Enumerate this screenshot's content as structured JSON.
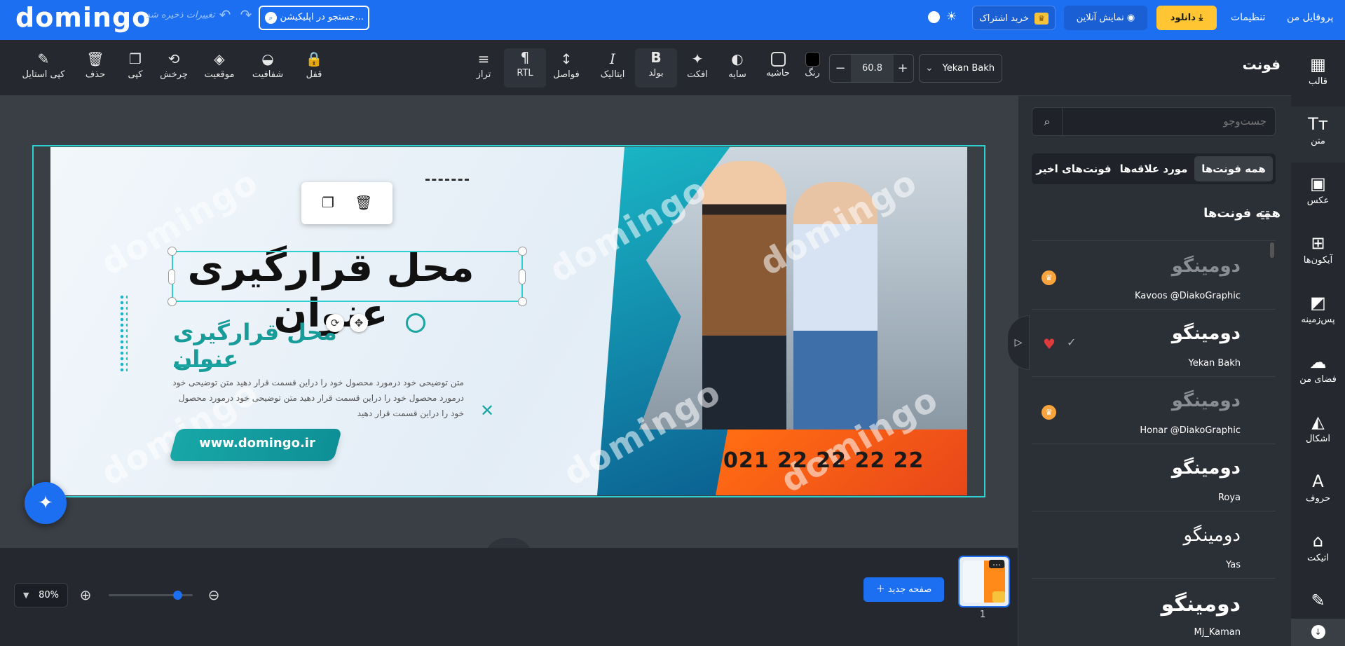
{
  "topbar": {
    "logo": "domingo",
    "saved_status": "تغییرات ذخیره شد",
    "search_text": "جستجو در اپلیکیشن...",
    "subscribe_label": "خرید اشتراک",
    "live_preview_label": "نمایش آنلاین",
    "download_label": "دانلود",
    "settings_label": "تنظیمات",
    "profile_label": "پروفایل من"
  },
  "toolbar": {
    "left_tools": [
      "کپی استایل",
      "حذف",
      "کپی",
      "چرخش",
      "موقعیت",
      "شفافیت",
      "قفل"
    ],
    "text_tools": [
      "تراز",
      "RTL",
      "فواصل",
      "ایتالیک",
      "بولد",
      "افکت",
      "سایه",
      "حاشیه",
      "رنگ"
    ],
    "font_size": "60.8",
    "font_name": "Yekan Bakh",
    "colors": {
      "border_swatch": "#1a1a1a",
      "color_swatch": "#000000"
    }
  },
  "design": {
    "title": "محل قرارگیری عنوان",
    "subtitle": "محل قرارگیری عنوان",
    "description": "متن توضیحی خود درمورد محصول خود را دراین قسمت قرار دهید متن توضیحی خود درمورد محصول خود را دراین قسمت قرار دهید متن توضیحی خود درمورد محصول خود را دراین قسمت قرار دهید",
    "url": "www.domingo.ir",
    "phone": "021 22 22 22 22",
    "watermark": "domingo"
  },
  "bottom": {
    "zoom": "80%",
    "new_page_label": "صفحه جدید",
    "page_number": "1"
  },
  "rail": {
    "items": [
      "قالب",
      "متن",
      "عکس",
      "آیکون‌ها",
      "پس‌زمینه",
      "فضای من",
      "اشکال",
      "حروف",
      "اتیکت",
      "..."
    ]
  },
  "panel": {
    "title": "فونت",
    "search_placeholder": "جست‌وجو",
    "tabs": [
      "همه فونت‌ها",
      "مورد علاقه‌ها",
      "فونت‌های اخیر"
    ],
    "list_title": "همه فونت‌ها",
    "fonts": [
      {
        "sample": "دومینگو",
        "name": "Kavoos @DiakoGraphic",
        "premium": true,
        "favorite": false
      },
      {
        "sample": "دومینگو",
        "name": "Yekan Bakh",
        "premium": false,
        "favorite": true
      },
      {
        "sample": "دومینگو",
        "name": "Honar @DiakoGraphic",
        "premium": true,
        "favorite": false
      },
      {
        "sample": "دومینگو",
        "name": "Roya",
        "premium": false,
        "favorite": false
      },
      {
        "sample": "دومینگو",
        "name": "Yas",
        "premium": false,
        "favorite": false
      },
      {
        "sample": "دومینگو",
        "name": "Mj_Kaman",
        "premium": false,
        "favorite": false
      }
    ]
  },
  "colors": {
    "brand": "#1d6ff2",
    "accent": "#ffc533",
    "teal": "#2fd0d0"
  }
}
